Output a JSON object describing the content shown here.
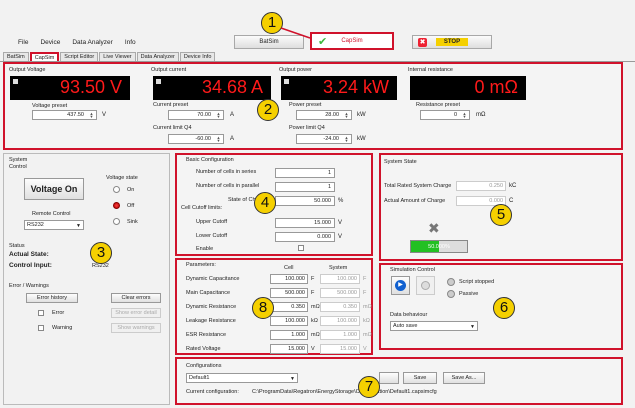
{
  "menu": [
    "File",
    "Device",
    "Data Analyzer",
    "Info"
  ],
  "toolbar": {
    "batsim": "BatSim",
    "capsim": "CapSim",
    "stop": "STOP"
  },
  "tabs": [
    "BatSim",
    "CapSim",
    "Script Editor",
    "Live Viewer",
    "Data Analyzer",
    "Device Info"
  ],
  "meters": {
    "voltage": {
      "title": "Output Voltage",
      "value": "93.50 V",
      "preset_label": "Voltage preset",
      "preset": "437.50",
      "unit": "V"
    },
    "current": {
      "title": "Output current",
      "value": "34.68 A",
      "preset_label": "Current preset",
      "preset": "70.00",
      "unit": "A",
      "limit_label": "Current limit Q4",
      "limit": "-60.00"
    },
    "power": {
      "title": "Output power",
      "value": "3.24 kW",
      "preset_label": "Power preset",
      "preset": "28.00",
      "unit": "kW",
      "limit_label": "Power limit Q4",
      "limit": "-24.00"
    },
    "resistance": {
      "title": "Internal resistance",
      "value": "0 mΩ",
      "preset_label": "Resistance preset",
      "preset": "0",
      "unit": "mΩ"
    }
  },
  "system": {
    "title": "System",
    "control": "Control",
    "voltage_on": "Voltage On",
    "voltage_state": "Voltage state",
    "on": "On",
    "off": "Off",
    "sink": "Sink",
    "remote_control": "Remote Control",
    "remote_value": "RS232",
    "status": "Status",
    "actual_state": "Actual State:",
    "control_input": "Control Input:",
    "control_input_value": "RS232",
    "errors_title": "Error / Warnings",
    "error_history": "Error history",
    "clear_errors": "Clear errors",
    "error": "Error",
    "warning": "Warning",
    "show_error_detail": "Show error detail",
    "show_warnings": "Show warnings"
  },
  "basic": {
    "title": "Basic Configuration",
    "cells_series_label": "Number of cells in series",
    "cells_series": "1",
    "cells_parallel_label": "Number of cells in parallel",
    "cells_parallel": "1",
    "soc_label": "State of Charge",
    "soc": "50.000",
    "soc_unit": "%",
    "cutoff_title": "Cell Cutoff limits:",
    "upper_label": "Upper Cutoff",
    "upper": "15.000",
    "upper_unit": "V",
    "lower_label": "Lower Cutoff",
    "lower": "0.000",
    "lower_unit": "V",
    "enable_label": "Enable"
  },
  "state": {
    "title": "System State",
    "total_label": "Total Rated System Charge",
    "total": "0.250",
    "total_unit": "kC",
    "actual_label": "Actual Amount of Charge",
    "actual": "0.000",
    "actual_unit": "C",
    "progress_text": "50.000%",
    "progress_fraction": 0.5
  },
  "params": {
    "title": "Parameters:",
    "col_cell": "Cell",
    "col_system": "System",
    "rows": [
      {
        "label": "Dynamic Capacitance",
        "cell": "100.000",
        "cell_unit": "F",
        "system": "100.000",
        "system_unit": "F"
      },
      {
        "label": "Main Capacitance",
        "cell": "500.000",
        "cell_unit": "F",
        "system": "500.000",
        "system_unit": "F"
      },
      {
        "label": "Dynamic Resistance",
        "cell": "0.350",
        "cell_unit": "mΩ",
        "system": "0.350",
        "system_unit": "mΩ"
      },
      {
        "label": "Leakage Resistance",
        "cell": "100.000",
        "cell_unit": "kΩ",
        "system": "100.000",
        "system_unit": "kΩ"
      },
      {
        "label": "ESR Resistance",
        "cell": "1.000",
        "cell_unit": "mΩ",
        "system": "1.000",
        "system_unit": "mΩ"
      },
      {
        "label": "Rated Voltage",
        "cell": "15.000",
        "cell_unit": "V",
        "system": "15.000",
        "system_unit": "V"
      }
    ]
  },
  "simulation": {
    "title": "Simulation Control",
    "script_stopped": "Script stopped",
    "passive": "Passive",
    "data_behaviour": "Data behaviour",
    "data_value": "Auto save"
  },
  "configs": {
    "title": "Configurations",
    "selected": "Default1",
    "save": "Save",
    "save_as": "Save As...",
    "current_label": "Current configuration:",
    "current_path": "C:\\ProgramData\\Regatron\\EnergyStorage\\Configuration\\Default1.capsimcfg"
  },
  "badges": [
    "1",
    "2",
    "3",
    "4",
    "5",
    "6",
    "7",
    "8"
  ],
  "colors": {
    "highlight": "#d0122b",
    "badge": "#f5d000",
    "lcd_text": "#ff1a1a",
    "progress": "#22c022"
  }
}
